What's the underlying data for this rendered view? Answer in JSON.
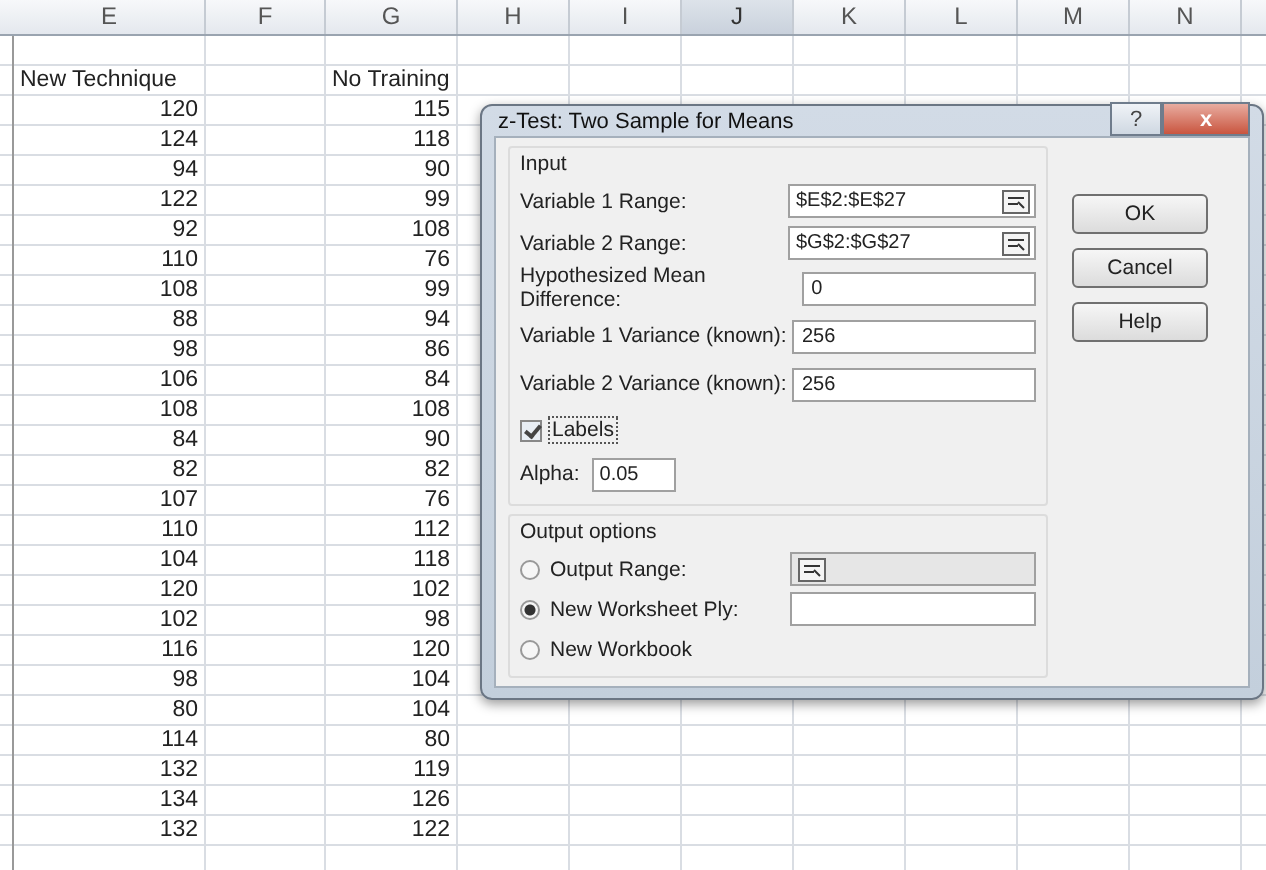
{
  "sheet": {
    "columns": [
      {
        "label": "E",
        "selected": false
      },
      {
        "label": "F",
        "selected": false
      },
      {
        "label": "G",
        "selected": false
      },
      {
        "label": "H",
        "selected": false
      },
      {
        "label": "I",
        "selected": false
      },
      {
        "label": "J",
        "selected": true
      },
      {
        "label": "K",
        "selected": false
      },
      {
        "label": "L",
        "selected": false
      },
      {
        "label": "M",
        "selected": false
      },
      {
        "label": "N",
        "selected": false
      }
    ],
    "headers": [
      "New Technique",
      "No Training"
    ],
    "rows": [
      [
        "120",
        "115"
      ],
      [
        "124",
        "118"
      ],
      [
        "94",
        "90"
      ],
      [
        "122",
        "99"
      ],
      [
        "92",
        "108"
      ],
      [
        "110",
        "76"
      ],
      [
        "108",
        "99"
      ],
      [
        "88",
        "94"
      ],
      [
        "98",
        "86"
      ],
      [
        "106",
        "84"
      ],
      [
        "108",
        "108"
      ],
      [
        "84",
        "90"
      ],
      [
        "82",
        "82"
      ],
      [
        "107",
        "76"
      ],
      [
        "110",
        "112"
      ],
      [
        "104",
        "118"
      ],
      [
        "120",
        "102"
      ],
      [
        "102",
        "98"
      ],
      [
        "116",
        "120"
      ],
      [
        "98",
        "104"
      ],
      [
        "80",
        "104"
      ],
      [
        "114",
        "80"
      ],
      [
        "132",
        "119"
      ],
      [
        "134",
        "126"
      ],
      [
        "132",
        "122"
      ]
    ]
  },
  "dialog": {
    "title": "z-Test: Two Sample for Means",
    "help_glyph": "?",
    "close_glyph": "x",
    "input_group": "Input",
    "ranges": [
      {
        "label": "Variable 1 Range:",
        "value": "$E$2:$E$27"
      },
      {
        "label": "Variable 2 Range:",
        "value": "$G$2:$G$27"
      }
    ],
    "fields": [
      {
        "label": "Hypothesized Mean Difference:",
        "value": "0"
      },
      {
        "label": "Variable 1 Variance (known):",
        "value": "256"
      },
      {
        "label": "Variable 2 Variance (known):",
        "value": "256"
      }
    ],
    "labels_checkbox": {
      "label": "Labels",
      "checked": true
    },
    "alpha": {
      "label": "Alpha:",
      "value": "0.05"
    },
    "output_group": "Output options",
    "outputs": [
      {
        "label": "Output Range:",
        "selected": false,
        "kind": "range"
      },
      {
        "label": "New Worksheet Ply:",
        "selected": true,
        "kind": "text"
      },
      {
        "label": "New Workbook",
        "selected": false,
        "kind": "none"
      }
    ],
    "buttons": [
      "OK",
      "Cancel",
      "Help"
    ]
  }
}
